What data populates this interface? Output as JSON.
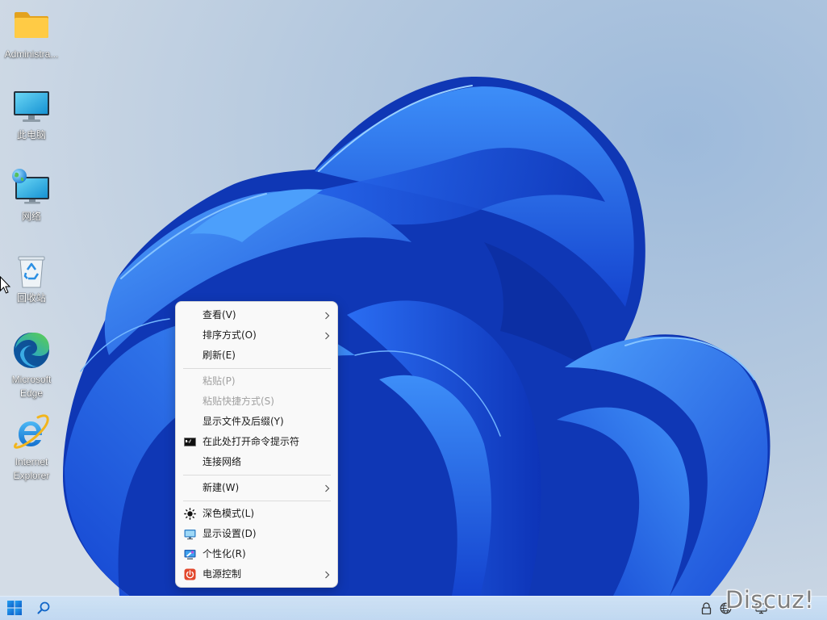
{
  "desktop": {
    "icons": [
      {
        "label": "Administra...",
        "icon": "folder-icon"
      },
      {
        "label": "此电脑",
        "icon": "this-pc-icon"
      },
      {
        "label": "网络",
        "icon": "network-icon"
      },
      {
        "label": "回收站",
        "icon": "recycle-bin-icon"
      },
      {
        "label": "Microsoft Edge",
        "icon": "edge-icon"
      },
      {
        "label": "Internet Explorer",
        "icon": "internet-explorer-icon"
      }
    ],
    "cursor": "arrow-cursor-icon"
  },
  "context_menu": {
    "items": [
      {
        "label": "查看(V)",
        "submenu": true
      },
      {
        "label": "排序方式(O)",
        "submenu": true
      },
      {
        "label": "刷新(E)"
      },
      {
        "separator": true
      },
      {
        "label": "粘贴(P)",
        "disabled": true
      },
      {
        "label": "粘贴快捷方式(S)",
        "disabled": true
      },
      {
        "label": "显示文件及后缀(Y)"
      },
      {
        "label": "在此处打开命令提示符",
        "icon": "command-prompt-icon"
      },
      {
        "label": "连接网络"
      },
      {
        "separator": true
      },
      {
        "label": "新建(W)",
        "submenu": true
      },
      {
        "separator": true
      },
      {
        "label": "深色模式(L)",
        "icon": "sun-icon"
      },
      {
        "label": "显示设置(D)",
        "icon": "display-settings-icon"
      },
      {
        "label": "个性化(R)",
        "icon": "personalize-icon"
      },
      {
        "label": "电源控制",
        "icon": "power-icon",
        "submenu": true
      }
    ]
  },
  "taskbar": {
    "start_icon": "windows-start-icon",
    "search_icon": "search-icon",
    "tray_icons": [
      "tray-lock-icon",
      "tray-network-icon",
      "tray-display-icon"
    ]
  },
  "watermark": "Discuz!",
  "colors": {
    "wallpaper_background": "#b5c9df",
    "bloom_blue": "#1f5ae6",
    "menu_background": "#f9f9f9",
    "menu_text": "#1b1b1b",
    "menu_disabled_text": "#a0a0a0",
    "taskbar_background": "#c6dcf1",
    "watermark": "#7f7f7f"
  }
}
